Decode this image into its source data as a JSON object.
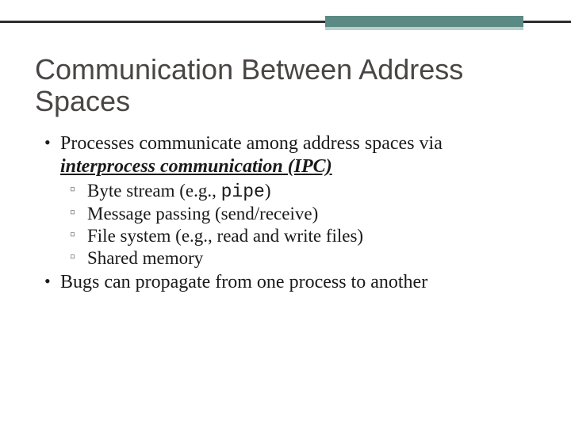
{
  "title": "Communication Between Address Spaces",
  "bullets": {
    "b1_pre": "Processes communicate among address spaces via ",
    "b1_ipc": "interprocess communication (IPC)",
    "sub": {
      "s1_pre": "Byte stream (e.g., ",
      "s1_mono": "pipe",
      "s1_post": ")",
      "s2": "Message passing (send/receive)",
      "s3": "File system (e.g., read and write files)",
      "s4": "Shared memory"
    },
    "b2": "Bugs can propagate from one process to another"
  }
}
